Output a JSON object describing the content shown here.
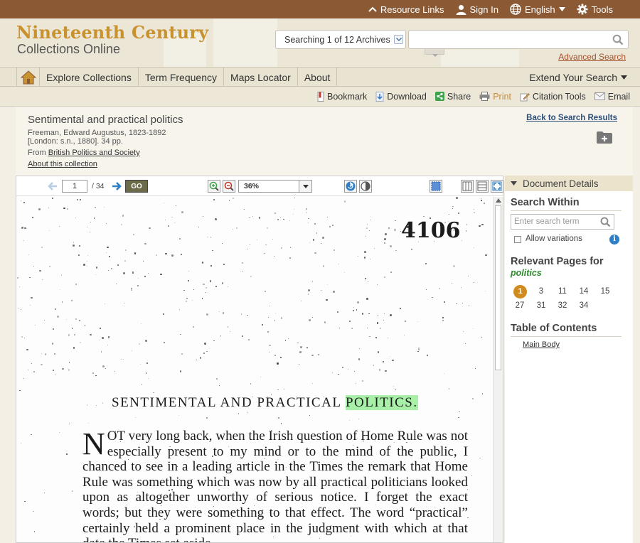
{
  "topbar": {
    "resource_links": "Resource Links",
    "sign_in": "Sign In",
    "language": "English",
    "tools": "Tools"
  },
  "header": {
    "logo_line1": "Nineteenth Century",
    "logo_line2": "Collections Online",
    "archive_selector": "Searching 1 of 12 Archives",
    "search_value": "",
    "advanced_search": "Advanced Search"
  },
  "nav": {
    "items": [
      "Explore Collections",
      "Term Frequency",
      "Maps Locator",
      "About"
    ],
    "extend": "Extend Your Search"
  },
  "toolbar": {
    "bookmark": "Bookmark",
    "download": "Download",
    "share": "Share",
    "print": "Print",
    "citation": "Citation Tools",
    "email": "Email"
  },
  "doc": {
    "title": "Sentimental and practical politics",
    "author": "Freeman, Edward Augustus, 1823-1892",
    "publication": "[London: s.n., 1880]. 34 pp.",
    "from_label": "From",
    "collection": "British Politics and Society",
    "about": "About this collection",
    "back": "Back to Search Results"
  },
  "viewer": {
    "page_value": "1",
    "page_total": "/ 34",
    "go": "GO",
    "zoom": "36%",
    "page_number": "4106",
    "page_title_pre": "SENTIMENTAL AND PRACTICAL",
    "page_title_hl": "POLITICS.",
    "dropcap": "N",
    "body_text": "OT very long back, when the Irish question of Home Rule was not especially present to my mind or to the mind of the public, I chanced to see in a leading article in the Times the remark that Home Rule was something which was now by all practical politicians looked upon as altogether unworthy of serious notice. I forget the exact words; but they were something to that effect. The word “practical” certainly held a prominent place in the judgment with which at that date the Times set aside"
  },
  "sidebar": {
    "doc_details": "Document Details",
    "search_within": "Search Within",
    "search_placeholder": "Enter search term",
    "allow_variations": "Allow variations",
    "info": "i",
    "relevant_pages": "Relevant Pages for",
    "term": "politics",
    "pages": [
      "1",
      "3",
      "11",
      "14",
      "15",
      "27",
      "31",
      "32",
      "34"
    ],
    "toc_title": "Table of Contents",
    "toc_item": "Main Body"
  },
  "colors": {
    "topbar": "#8b5a35",
    "logo": "#c8922f",
    "current_page": "#d08a1d",
    "highlight": "#a8f0a8",
    "link_blue": "#2c4e7a"
  }
}
